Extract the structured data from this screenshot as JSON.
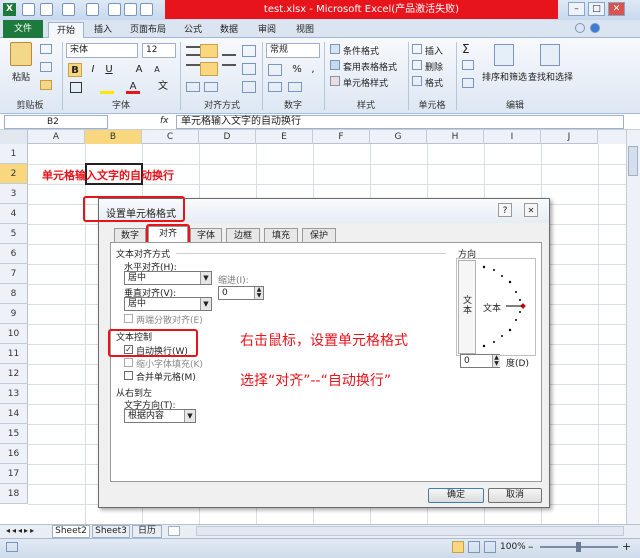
{
  "window": {
    "title": "test.xlsx - Microsoft Excel(产品激活失败)",
    "min": "–",
    "max": "□",
    "close": "✕"
  },
  "ribbon_tabs": [
    "文件",
    "开始",
    "插入",
    "页面布局",
    "公式",
    "数据",
    "审阅",
    "视图"
  ],
  "ribbon": {
    "clipboard": {
      "paste": "粘贴",
      "label": "剪贴板"
    },
    "font": {
      "name": "宋体",
      "size": "12",
      "bold": "B",
      "italic": "I",
      "underline": "U",
      "grow": "A",
      "shrink": "A",
      "color_a": "A",
      "wen": "文",
      "label": "字体"
    },
    "alignment": {
      "label": "对齐方式"
    },
    "number": {
      "format": "常规",
      "percent": "%",
      "comma": ",",
      "label": "数字"
    },
    "styles": {
      "cond": "条件格式",
      "table": "套用表格格式",
      "cell": "单元格样式",
      "label": "样式"
    },
    "cells": {
      "insert": "插入",
      "delete": "删除",
      "format": "格式",
      "label": "单元格"
    },
    "editing": {
      "sigma": "Σ",
      "sort": "排序和筛选",
      "find": "查找和选择",
      "label": "编辑"
    }
  },
  "formula_bar": {
    "name_box": "B2",
    "fx": "fx",
    "content": "单元格输入文字的自动换行"
  },
  "columns": [
    "A",
    "B",
    "C",
    "D",
    "E",
    "F",
    "G",
    "H",
    "I",
    "J"
  ],
  "rows": [
    "1",
    "2",
    "3",
    "4",
    "5",
    "6",
    "7",
    "8",
    "9",
    "10",
    "11",
    "12",
    "13",
    "14",
    "15",
    "16",
    "17",
    "18"
  ],
  "cells": {
    "b2": "单元格输入文字的自动换行"
  },
  "dialog": {
    "title": "设置单元格格式",
    "help": "?",
    "close": "✕",
    "tabs": [
      "数字",
      "对齐",
      "字体",
      "边框",
      "填充",
      "保护"
    ],
    "text_align_section": "文本对齐方式",
    "h_align_label": "水平对齐(H):",
    "h_align_value": "居中",
    "indent_label": "缩进(I):",
    "indent_value": "0",
    "v_align_label": "垂直对齐(V):",
    "v_align_value": "居中",
    "distributed": "两端分散对齐(E)",
    "text_control": "文本控制",
    "wrap": "自动换行(W)",
    "shrink": "缩小字体填充(K)",
    "merge": "合并单元格(M)",
    "rtl_section": "从右到左",
    "text_dir_label": "文字方向(T):",
    "text_dir_value": "根据内容",
    "orientation": "方向",
    "vertical_text": "文本",
    "horizontal_text": "文本",
    "degree_value": "0",
    "degree_label": "度(D)",
    "ok": "确定",
    "cancel": "取消"
  },
  "annotations": {
    "line1": "右击鼠标，设置单元格格式",
    "line2": "选择“对齐”--“自动换行”"
  },
  "sheets": [
    "Sheet2",
    "Sheet3",
    "日历"
  ],
  "status": {
    "zoom": "100%",
    "minus": "–",
    "plus": "+"
  },
  "colors": {
    "accent_red": "#e8141c",
    "file_tab": "#1d7a3c",
    "ribbon": "#dde7f3"
  }
}
